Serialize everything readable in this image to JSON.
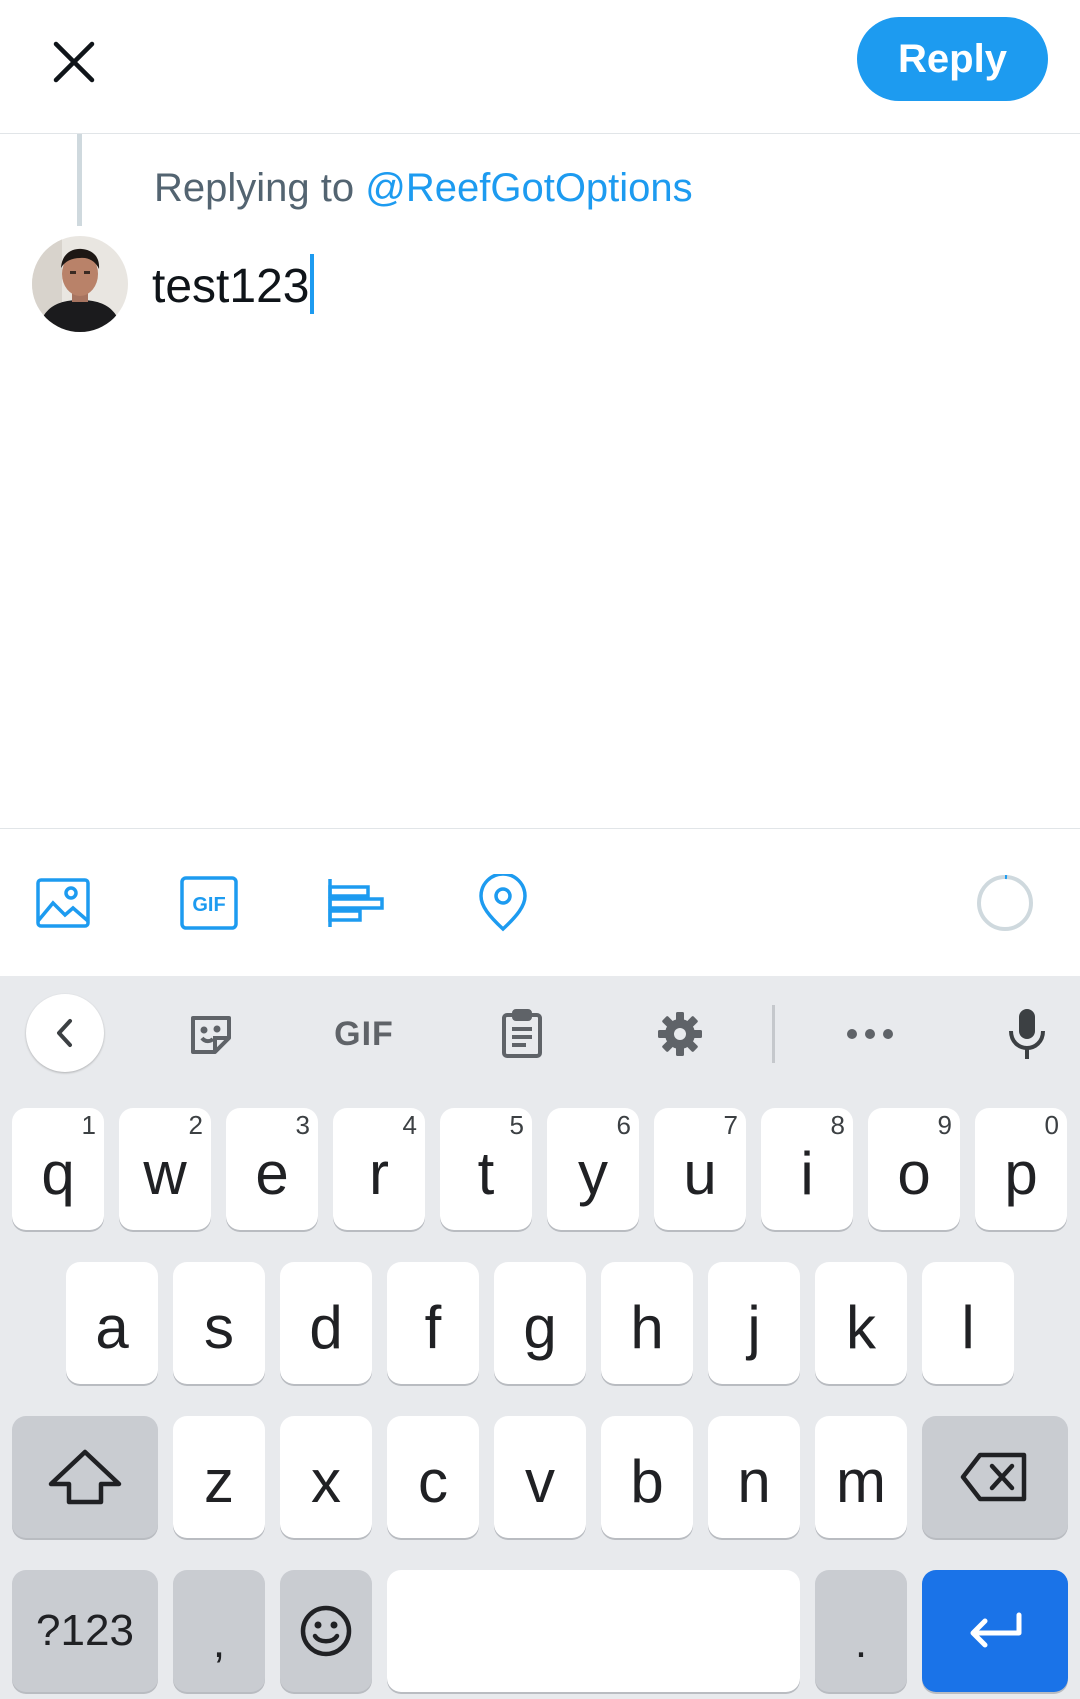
{
  "header": {
    "reply_label": "Reply"
  },
  "compose": {
    "replying_prefix": "Replying to",
    "replying_handle": "@ReefGotOptions",
    "text": "test123"
  },
  "keyboard": {
    "suggestion_gif_label": "GIF",
    "row1": [
      {
        "key": "q",
        "hint": "1"
      },
      {
        "key": "w",
        "hint": "2"
      },
      {
        "key": "e",
        "hint": "3"
      },
      {
        "key": "r",
        "hint": "4"
      },
      {
        "key": "t",
        "hint": "5"
      },
      {
        "key": "y",
        "hint": "6"
      },
      {
        "key": "u",
        "hint": "7"
      },
      {
        "key": "i",
        "hint": "8"
      },
      {
        "key": "o",
        "hint": "9"
      },
      {
        "key": "p",
        "hint": "0"
      }
    ],
    "row2": [
      "a",
      "s",
      "d",
      "f",
      "g",
      "h",
      "j",
      "k",
      "l"
    ],
    "row3": [
      "z",
      "x",
      "c",
      "v",
      "b",
      "n",
      "m"
    ],
    "symbols_label": "?123",
    "comma_label": ",",
    "period_label": "."
  },
  "colors": {
    "accent": "#1d9bf0",
    "enter_key": "#1a73e8",
    "keyboard_bg": "#e8eaed"
  }
}
